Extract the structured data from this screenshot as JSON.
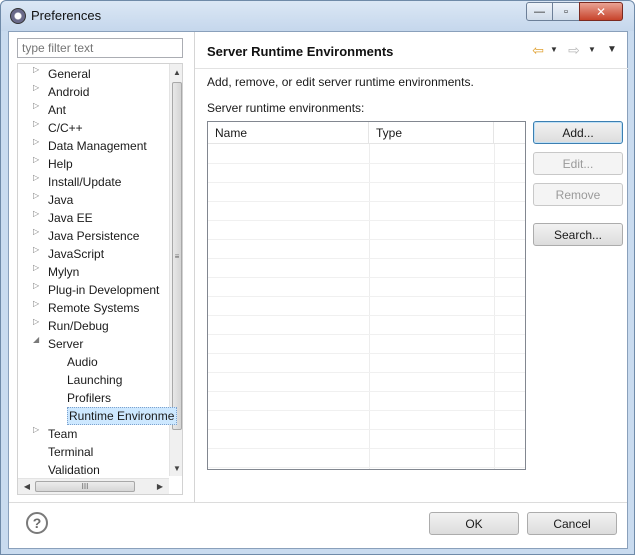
{
  "window": {
    "title": "Preferences"
  },
  "title_buttons": {
    "minimize": "—",
    "maximize": "▫",
    "close": "✕"
  },
  "filter": {
    "placeholder": "type filter text",
    "value": ""
  },
  "tree": {
    "items": [
      {
        "label": "General",
        "arrow": "▷",
        "indent": 0
      },
      {
        "label": "Android",
        "arrow": "▷",
        "indent": 0
      },
      {
        "label": "Ant",
        "arrow": "▷",
        "indent": 0
      },
      {
        "label": "C/C++",
        "arrow": "▷",
        "indent": 0
      },
      {
        "label": "Data Management",
        "arrow": "▷",
        "indent": 0
      },
      {
        "label": "Help",
        "arrow": "▷",
        "indent": 0
      },
      {
        "label": "Install/Update",
        "arrow": "▷",
        "indent": 0
      },
      {
        "label": "Java",
        "arrow": "▷",
        "indent": 0
      },
      {
        "label": "Java EE",
        "arrow": "▷",
        "indent": 0
      },
      {
        "label": "Java Persistence",
        "arrow": "▷",
        "indent": 0
      },
      {
        "label": "JavaScript",
        "arrow": "▷",
        "indent": 0
      },
      {
        "label": "Mylyn",
        "arrow": "▷",
        "indent": 0
      },
      {
        "label": "Plug-in Development",
        "arrow": "▷",
        "indent": 0
      },
      {
        "label": "Remote Systems",
        "arrow": "▷",
        "indent": 0
      },
      {
        "label": "Run/Debug",
        "arrow": "▷",
        "indent": 0
      },
      {
        "label": "Server",
        "arrow": "◢",
        "indent": 0
      },
      {
        "label": "Audio",
        "arrow": "",
        "indent": 1
      },
      {
        "label": "Launching",
        "arrow": "",
        "indent": 1
      },
      {
        "label": "Profilers",
        "arrow": "",
        "indent": 1
      },
      {
        "label": "Runtime Environme",
        "arrow": "",
        "indent": 1,
        "selected": true
      },
      {
        "label": "Team",
        "arrow": "▷",
        "indent": 0
      },
      {
        "label": "Terminal",
        "arrow": "",
        "indent": 0
      },
      {
        "label": "Validation",
        "arrow": "",
        "indent": 0
      }
    ],
    "scroll_grip": "≡",
    "hscroll_grip": "III"
  },
  "page": {
    "title": "Server Runtime Environments",
    "description": "Add, remove, or edit server runtime environments.",
    "list_label": "Server runtime environments:",
    "columns": [
      "Name",
      "Type"
    ],
    "rows": []
  },
  "nav": {
    "back": "⇦",
    "forward": "⇨",
    "dropdown": "▼",
    "menu": "▼"
  },
  "colors": {
    "back_arrow": "#e0a030",
    "forward_arrow": "#b8b8b8",
    "selection": "#cde8ff"
  },
  "buttons": {
    "add": "Add...",
    "edit": "Edit...",
    "remove": "Remove",
    "search": "Search...",
    "ok": "OK",
    "cancel": "Cancel"
  },
  "help": {
    "icon": "?"
  }
}
